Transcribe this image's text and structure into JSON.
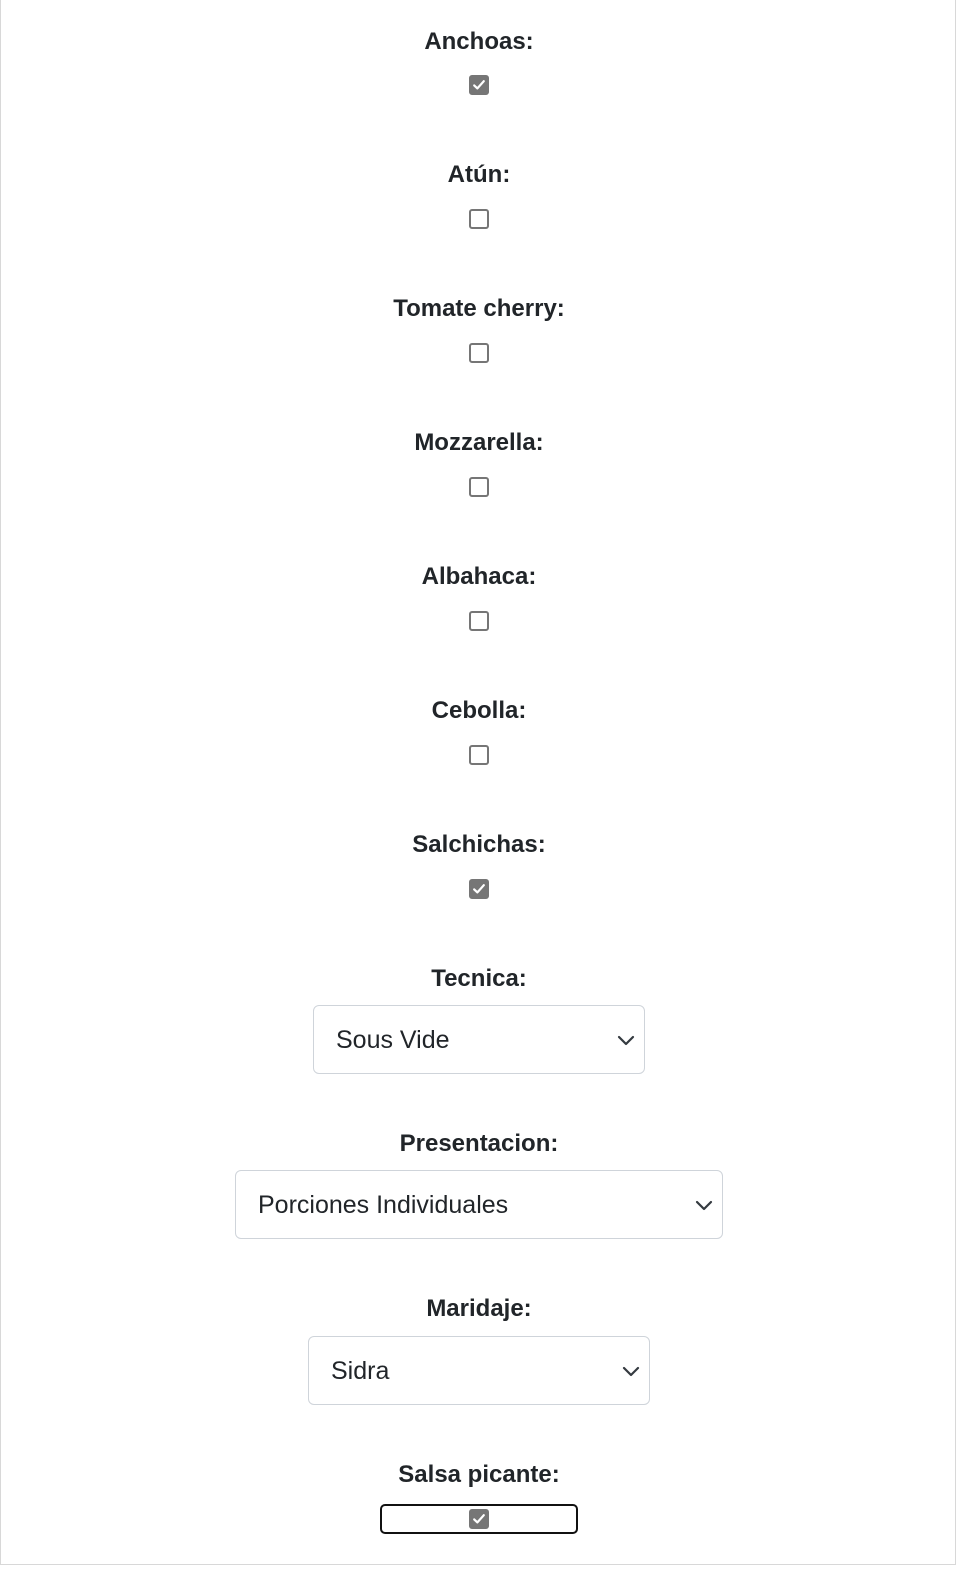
{
  "fields": {
    "anchoas": {
      "label": "Anchoas:",
      "checked": true
    },
    "atun": {
      "label": "Atún:",
      "checked": false
    },
    "tomate_cherry": {
      "label": "Tomate cherry:",
      "checked": false
    },
    "mozzarella": {
      "label": "Mozzarella:",
      "checked": false
    },
    "albahaca": {
      "label": "Albahaca:",
      "checked": false
    },
    "cebolla": {
      "label": "Cebolla:",
      "checked": false
    },
    "salchichas": {
      "label": "Salchichas:",
      "checked": true
    },
    "tecnica": {
      "label": "Tecnica:",
      "value": "Sous Vide"
    },
    "presentacion": {
      "label": "Presentacion:",
      "value": "Porciones Individuales"
    },
    "maridaje": {
      "label": "Maridaje:",
      "value": "Sidra"
    },
    "salsa_picante": {
      "label": "Salsa picante:",
      "checked": true,
      "focused": true
    }
  },
  "icons": {
    "checkbox_check": "check-icon",
    "select_arrow": "chevron-down-icon"
  },
  "colors": {
    "text": "#212529",
    "checkbox_checked": "#767676",
    "checkbox_border": "#767676",
    "select_border": "#cfd4da",
    "focus_ring": "#111111"
  }
}
